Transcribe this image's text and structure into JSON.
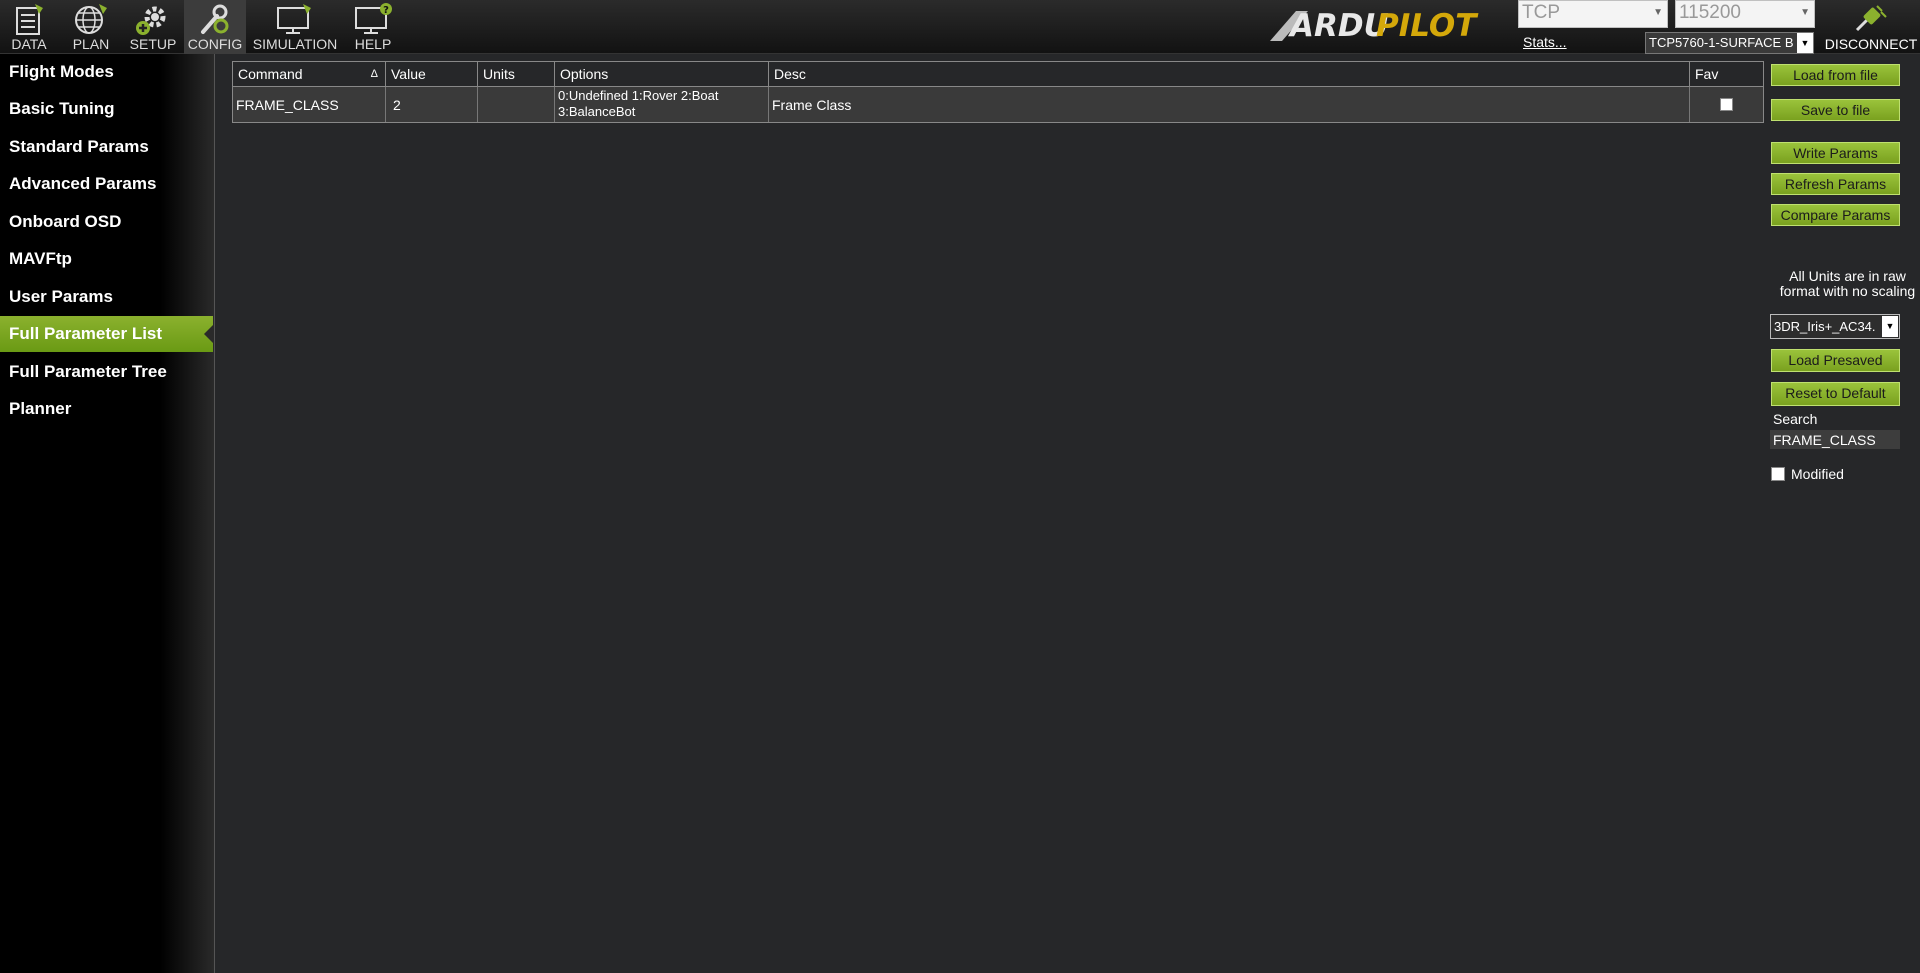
{
  "toolbar": {
    "items": [
      {
        "label": "DATA",
        "icon": "data-icon"
      },
      {
        "label": "PLAN",
        "icon": "plan-globe-icon"
      },
      {
        "label": "SETUP",
        "icon": "setup-gear-icon"
      },
      {
        "label": "CONFIG",
        "icon": "config-wrench-icon",
        "active": true
      },
      {
        "label": "SIMULATION",
        "icon": "simulation-monitor-icon"
      },
      {
        "label": "HELP",
        "icon": "help-monitor-icon"
      }
    ],
    "brand_parts": [
      "ARDU",
      "PILOT"
    ],
    "connection_type": "TCP",
    "baud_rate": "115200",
    "stats_label": "Stats...",
    "port_name": "TCP5760-1-SURFACE B",
    "disconnect_label": "DISCONNECT"
  },
  "sidebar": {
    "items": [
      {
        "label": "Flight Modes"
      },
      {
        "label": "Basic Tuning"
      },
      {
        "label": "Standard Params"
      },
      {
        "label": "Advanced Params"
      },
      {
        "label": "Onboard OSD"
      },
      {
        "label": "MAVFtp"
      },
      {
        "label": "User Params"
      },
      {
        "label": "Full Parameter List",
        "active": true
      },
      {
        "label": "Full Parameter Tree"
      },
      {
        "label": "Planner"
      }
    ]
  },
  "grid": {
    "columns": [
      "Command",
      "Value",
      "Units",
      "Options",
      "Desc",
      "Fav"
    ],
    "sort_indicator": "Δ",
    "rows": [
      {
        "command": "FRAME_CLASS",
        "value": "2",
        "units": "",
        "options_line1": "0:Undefined 1:Rover 2:Boat",
        "options_line2": "3:BalanceBot",
        "desc": "Frame Class",
        "fav": false
      }
    ]
  },
  "panel": {
    "load_from_file": "Load from file",
    "save_to_file": "Save to file",
    "write_params": "Write Params",
    "refresh_params": "Refresh Params",
    "compare_params": "Compare Params",
    "units_note": "All Units are in raw format with no scaling",
    "preset_value": "3DR_Iris+_AC34.",
    "load_presaved": "Load Presaved",
    "reset_to_default": "Reset to Default",
    "search_label": "Search",
    "search_value": "FRAME_CLASS",
    "modified_label": "Modified",
    "modified_checked": false
  },
  "colors": {
    "accent_green": "#8bb12e",
    "background": "#262729",
    "sidebar": "#000000"
  }
}
